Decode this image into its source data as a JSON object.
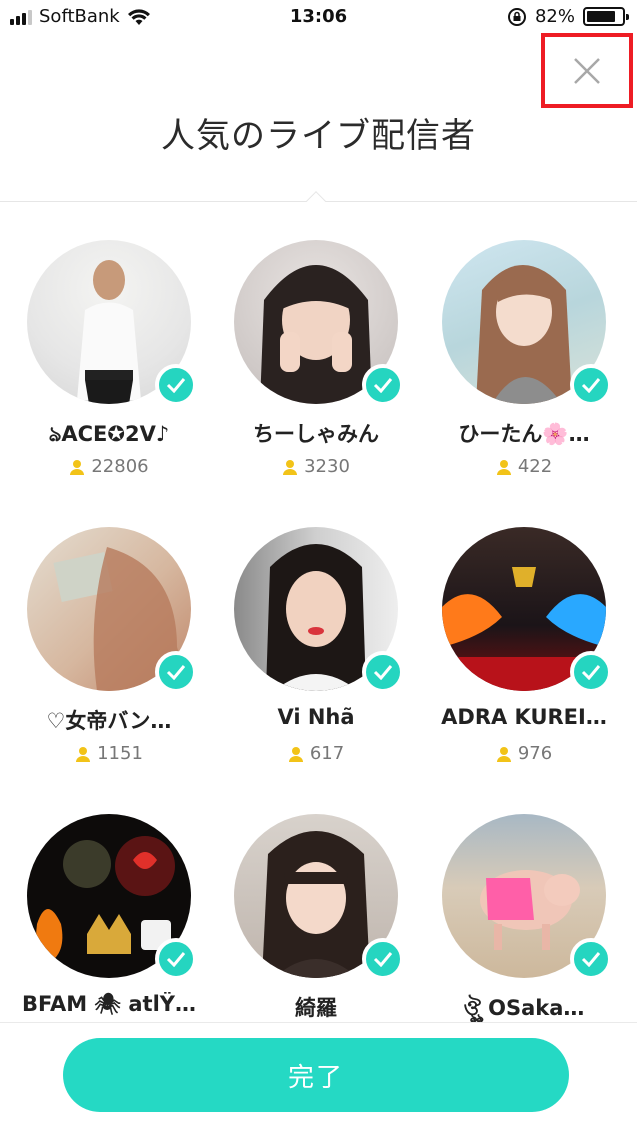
{
  "status_bar": {
    "carrier": "SoftBank",
    "time": "13:06",
    "battery_percent": "82%",
    "battery_level": 0.82
  },
  "header": {
    "title": "人気のライブ配信者",
    "close_icon": "close-icon"
  },
  "streamers": [
    {
      "name": "ঌACE✪2V♪",
      "followers": "22806"
    },
    {
      "name": "ちーしゃみん",
      "followers": "3230"
    },
    {
      "name": "ひーたん🌸…",
      "followers": "422"
    },
    {
      "name": "♡女帝バン…",
      "followers": "1151"
    },
    {
      "name": "Vi Nhã",
      "followers": "617"
    },
    {
      "name": "ADRA KUREI…",
      "followers": "976"
    },
    {
      "name": "BFAM 🕷 atlŸ…",
      "followers": ""
    },
    {
      "name": "綺羅",
      "followers": ""
    },
    {
      "name": "ঔৣ OSaka…",
      "followers": ""
    }
  ],
  "footer": {
    "done_label": "完了"
  },
  "colors": {
    "accent": "#25d9c4",
    "badge": "#25d5c0",
    "follower_icon": "#f2c318",
    "highlight_box": "#ee1c24"
  }
}
